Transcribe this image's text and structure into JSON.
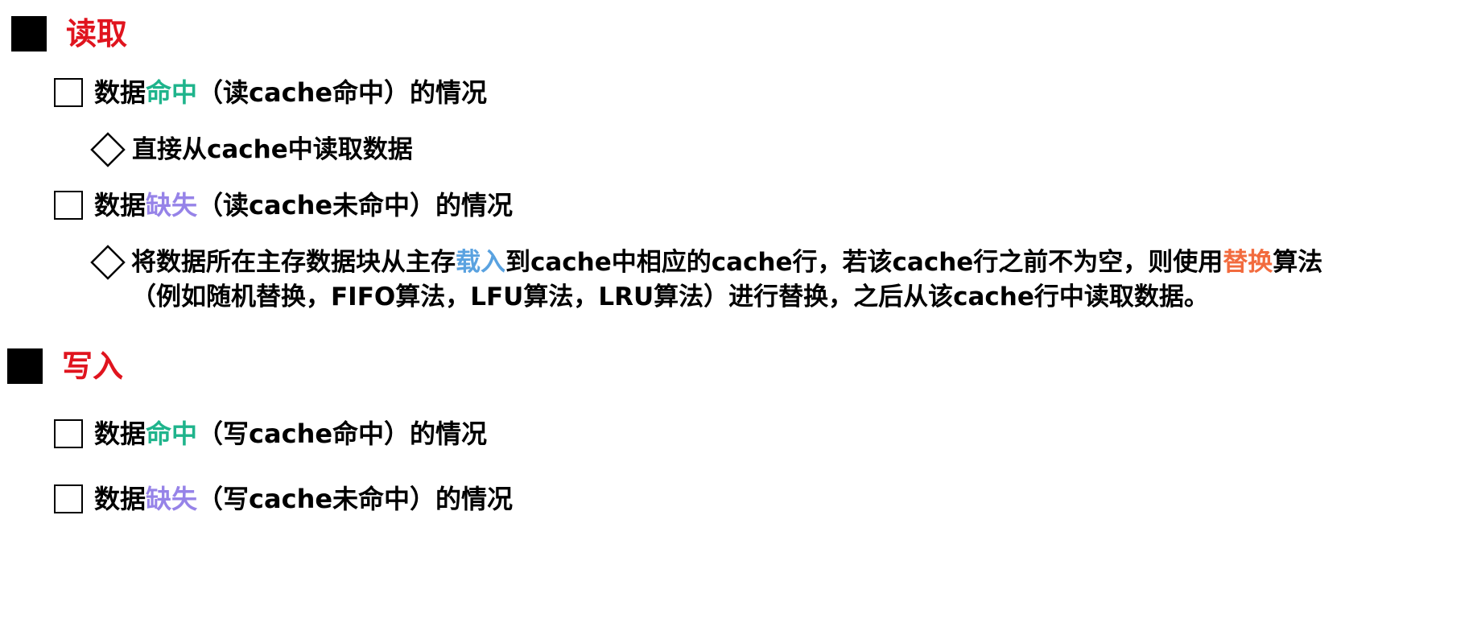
{
  "colors": {
    "section": "#e0141e",
    "hit": "#1fb48c",
    "miss": "#9683e8",
    "load": "#5aa2e0",
    "replace": "#f26b3e"
  },
  "read": {
    "title": "读取",
    "hit": {
      "prefix": "数据",
      "highlight": "命中",
      "suffix": "（读cache命中）的情况",
      "sub": "直接从cache中读取数据"
    },
    "miss": {
      "prefix": "数据",
      "highlight": "缺失",
      "suffix": "（读cache未命中）的情况",
      "sub_part1": "将数据所在主存数据块从主存",
      "sub_load": "载入",
      "sub_part2": "到cache中相应的cache行，若该cache行之前不为空，则使用",
      "sub_replace": "替换",
      "sub_part3": "算法",
      "sub_line2": "（例如随机替换，FIFO算法，LFU算法，LRU算法）进行替换，之后从该cache行中读取数据。"
    }
  },
  "write": {
    "title": "写入",
    "hit": {
      "prefix": "数据",
      "highlight": "命中",
      "suffix": "（写cache命中）的情况"
    },
    "miss": {
      "prefix": "数据",
      "highlight": "缺失",
      "suffix": "（写cache未命中）的情况"
    }
  }
}
